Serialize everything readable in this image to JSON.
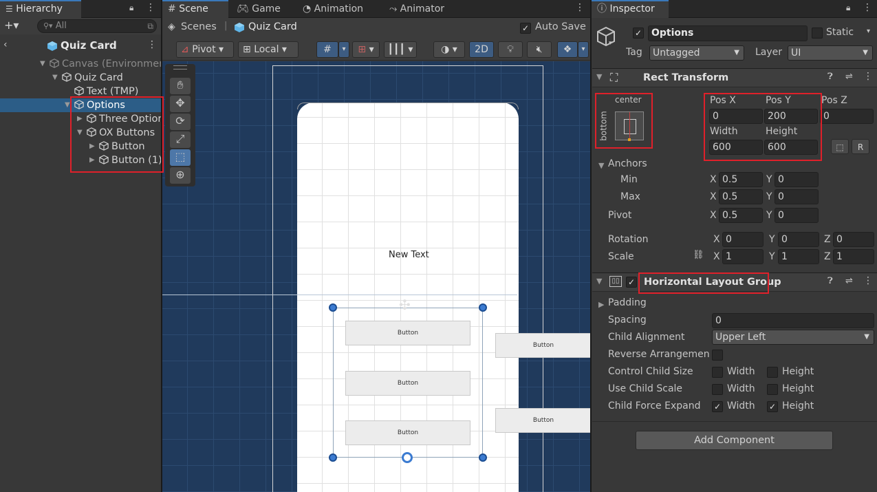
{
  "hierarchy": {
    "tab_label": "Hierarchy",
    "add_label": "+▾",
    "search_placeholder": "All",
    "scene_title": "Quiz Card",
    "rows": [
      {
        "label": "Canvas (Environment)",
        "indent": 0,
        "expanded": true,
        "dim": true
      },
      {
        "label": "Quiz Card",
        "indent": 1,
        "expanded": true
      },
      {
        "label": "Text (TMP)",
        "indent": 2,
        "expanded": false,
        "leaf": true
      },
      {
        "label": "Options",
        "indent": 2,
        "expanded": true,
        "selected": true
      },
      {
        "label": "Three Options",
        "indent": 3,
        "expanded": false
      },
      {
        "label": "OX Buttons",
        "indent": 3,
        "expanded": true
      },
      {
        "label": "Button",
        "indent": 4,
        "expanded": false
      },
      {
        "label": "Button (1)",
        "indent": 4,
        "expanded": false
      }
    ]
  },
  "scene": {
    "tabs": [
      "Scene",
      "Game",
      "Animation",
      "Animator"
    ],
    "breadcrumb_root": "Scenes",
    "breadcrumb_current": "Quiz Card",
    "auto_save_label": "Auto Save",
    "auto_save_checked": true,
    "pivot_label": "Pivot",
    "local_label": "Local",
    "mode_2d_label": "2D",
    "new_text_label": "New Text",
    "button_labels": [
      "Button",
      "Button",
      "Button",
      "Button",
      "Button"
    ]
  },
  "inspector": {
    "tab_label": "Inspector",
    "object_name": "Options",
    "active_checked": true,
    "static_label": "Static",
    "tag_label": "Tag",
    "tag_value": "Untagged",
    "layer_label": "Layer",
    "layer_value": "UI",
    "rect_transform": {
      "title": "Rect Transform",
      "anchor_h": "center",
      "anchor_v": "bottom",
      "pos_x_label": "Pos X",
      "pos_x": "0",
      "pos_y_label": "Pos Y",
      "pos_y": "200",
      "pos_z_label": "Pos Z",
      "pos_z": "0",
      "width_label": "Width",
      "width": "600",
      "height_label": "Height",
      "height": "600",
      "anchors_label": "Anchors",
      "min_label": "Min",
      "min_x": "0.5",
      "min_y": "0",
      "max_label": "Max",
      "max_x": "0.5",
      "max_y": "0",
      "pivot_label": "Pivot",
      "pivot_x": "0.5",
      "pivot_y": "0",
      "rotation_label": "Rotation",
      "rot_x": "0",
      "rot_y": "0",
      "rot_z": "0",
      "scale_label": "Scale",
      "scale_x": "1",
      "scale_y": "1",
      "scale_z": "1",
      "x": "X",
      "y": "Y",
      "z": "Z"
    },
    "hlg": {
      "title": "Horizontal Layout Group",
      "padding_label": "Padding",
      "spacing_label": "Spacing",
      "spacing": "0",
      "child_alignment_label": "Child Alignment",
      "child_alignment": "Upper Left",
      "reverse_label": "Reverse Arrangement",
      "control_size_label": "Control Child Size",
      "use_scale_label": "Use Child Scale",
      "force_expand_label": "Child Force Expand",
      "width_label": "Width",
      "height_label": "Height"
    },
    "add_component_label": "Add Component"
  },
  "colors": {
    "accent": "#3a79bb",
    "selection": "#2c5d87",
    "highlight_box": "#e0202a",
    "scene_bg": "#203a5c"
  }
}
